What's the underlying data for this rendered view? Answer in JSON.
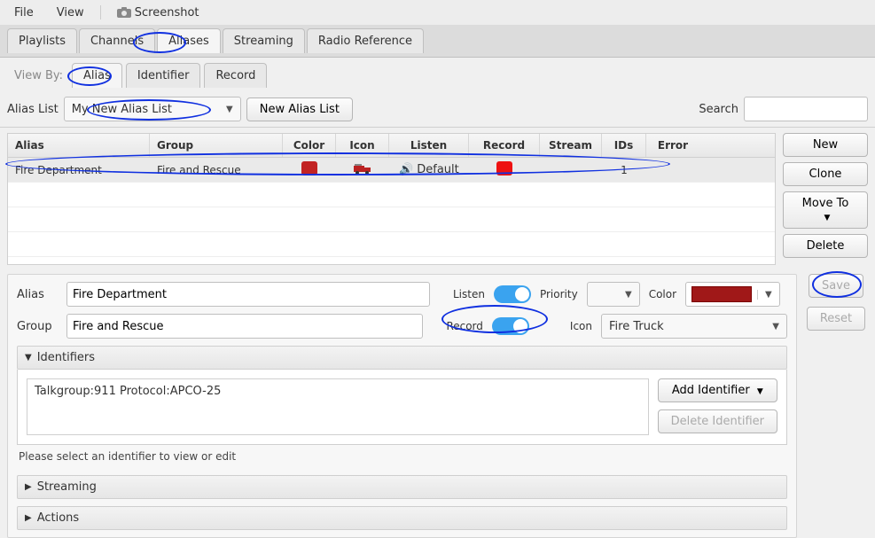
{
  "menubar": {
    "file": "File",
    "view": "View",
    "screenshot": "Screenshot"
  },
  "main_tabs": {
    "playlists": "Playlists",
    "channels": "Channels",
    "aliases": "Aliases",
    "streaming": "Streaming",
    "radio_reference": "Radio Reference"
  },
  "viewby_label": "View By:",
  "sub_tabs": {
    "alias": "Alias",
    "identifier": "Identifier",
    "record": "Record"
  },
  "aliaslist": {
    "label": "Alias List",
    "combo_value": "My New Alias List",
    "new_button": "New Alias List"
  },
  "search": {
    "label": "Search",
    "value": ""
  },
  "table": {
    "headers": {
      "alias": "Alias",
      "group": "Group",
      "color": "Color",
      "icon": "Icon",
      "listen": "Listen",
      "record": "Record",
      "stream": "Stream",
      "ids": "IDs",
      "error": "Error"
    },
    "row0": {
      "alias": "Fire Department",
      "group": "Fire and Rescue",
      "color_hex": "#c22323",
      "icon_name": "fire-truck-icon",
      "listen": "Default",
      "record_hex": "#e11",
      "ids": "1"
    }
  },
  "side_buttons": {
    "new": "New",
    "clone": "Clone",
    "move_to": "Move To",
    "delete": "Delete"
  },
  "detail": {
    "alias_label": "Alias",
    "alias_value": "Fire Department",
    "group_label": "Group",
    "group_value": "Fire and Rescue",
    "listen_label": "Listen",
    "priority_label": "Priority",
    "color_label": "Color",
    "color_hex": "#a01818",
    "record_label": "Record",
    "icon_label": "Icon",
    "icon_value": "Fire Truck",
    "save": "Save",
    "reset": "Reset"
  },
  "identifiers": {
    "header": "Identifiers",
    "item0": "Talkgroup:911 Protocol:APCO-25",
    "add_button": "Add Identifier",
    "delete_button": "Delete Identifier",
    "hint": "Please select an identifier to view or edit"
  },
  "streaming_header": "Streaming",
  "actions_header": "Actions"
}
